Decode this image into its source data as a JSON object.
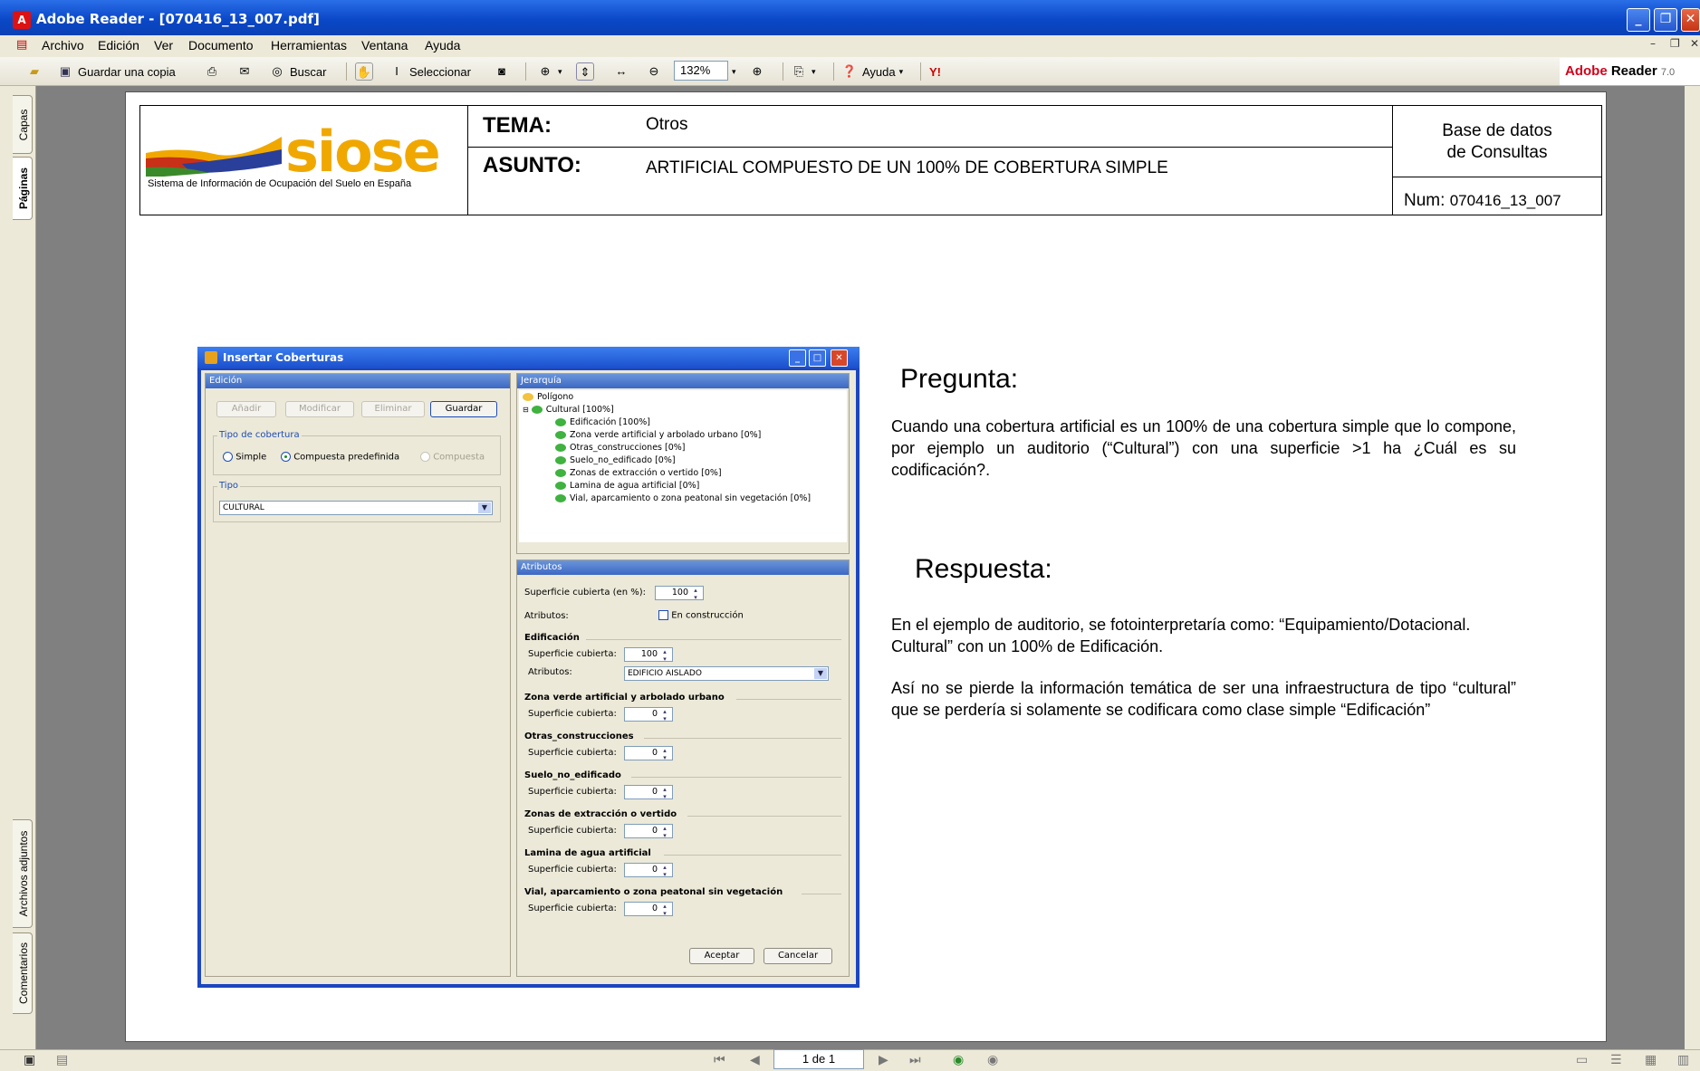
{
  "window": {
    "title": "Adobe Reader - [070416_13_007.pdf]"
  },
  "menu": [
    "Archivo",
    "Edición",
    "Ver",
    "Documento",
    "Herramientas",
    "Ventana",
    "Ayuda"
  ],
  "toolbar": {
    "save_copy": "Guardar una copia",
    "search": "Buscar",
    "select": "Seleccionar",
    "zoom": "132%",
    "help": "Ayuda",
    "brand_adobe": "Adobe",
    "brand_reader": "Reader",
    "brand_version": "7.0"
  },
  "side_tabs": {
    "layers": "Capas",
    "pages": "Páginas",
    "attachments": "Archivos adjuntos",
    "comments": "Comentarios"
  },
  "header": {
    "logo_text": "siose",
    "logo_subtitle": "Sistema de Información de Ocupación del Suelo en España",
    "tema_label": "TEMA:",
    "tema_value": "Otros",
    "asunto_label": "ASUNTO:",
    "asunto_value": "ARTIFICIAL COMPUESTO DE UN 100% DE COBERTURA SIMPLE",
    "db_line1": "Base de datos",
    "db_line2": "de Consultas",
    "num_label": "Num:",
    "num_value": "070416_13_007"
  },
  "dialog": {
    "title": "Insertar Coberturas",
    "edition_header": "Edición",
    "btn_add": "Añadir",
    "btn_modify": "Modificar",
    "btn_delete": "Eliminar",
    "btn_save": "Guardar",
    "tipo_cobertura_legend": "Tipo de cobertura",
    "radio_simple": "Simple",
    "radio_compuesta_predef": "Compuesta predefinida",
    "radio_compuesta": "Compuesta",
    "tipo_legend": "Tipo",
    "tipo_value": "CULTURAL",
    "hierarchy_header": "Jerarquía",
    "tree": {
      "root": "Polígono",
      "parent": "Cultural [100%]",
      "children": [
        "Edificación [100%]",
        "Zona verde artificial y arbolado urbano [0%]",
        "Otras_construcciones [0%]",
        "Suelo_no_edificado [0%]",
        "Zonas de extracción o vertido [0%]",
        "Lamina de agua artificial [0%]",
        "Vial, aparcamiento o zona peatonal sin vegetación [0%]"
      ]
    },
    "attributes_header": "Atributos",
    "sup_cubierta_pct_label": "Superficie cubierta (en %):",
    "sup_cubierta_pct_value": "100",
    "atributos_label": "Atributos:",
    "en_construccion": "En construcción",
    "sub_sup_label": "Superficie cubierta:",
    "sub_attr_label": "Atributos:",
    "sections": [
      {
        "name": "Edificación",
        "value": "100",
        "attr": "EDIFICIO AISLADO"
      },
      {
        "name": "Zona verde artificial y arbolado urbano",
        "value": "0"
      },
      {
        "name": "Otras_construcciones",
        "value": "0"
      },
      {
        "name": "Suelo_no_edificado",
        "value": "0"
      },
      {
        "name": "Zonas de extracción o vertido",
        "value": "0"
      },
      {
        "name": "Lamina de agua artificial",
        "value": "0"
      },
      {
        "name": "Vial, aparcamiento o zona peatonal sin vegetación",
        "value": "0"
      }
    ],
    "btn_accept": "Aceptar",
    "btn_cancel": "Cancelar"
  },
  "content": {
    "pregunta_title": "Pregunta:",
    "pregunta_text": "Cuando una cobertura artificial es un 100% de una cobertura simple que lo compone, por ejemplo un auditorio (“Cultural”) con una superficie  >1 ha ¿Cuál es su codificación?.",
    "respuesta_title": "Respuesta:",
    "respuesta_text1": "En  el ejemplo de auditorio, se fotointerpretaría como: “Equipamiento/Dotacional. Cultural” con un 100% de Edificación.",
    "respuesta_text2": "Así no se pierde la información temática de ser una infraestructura de tipo “cultural” que se perdería si solamente se codificara como clase simple “Edificación”"
  },
  "statusbar": {
    "page_indicator": "1 de 1"
  }
}
